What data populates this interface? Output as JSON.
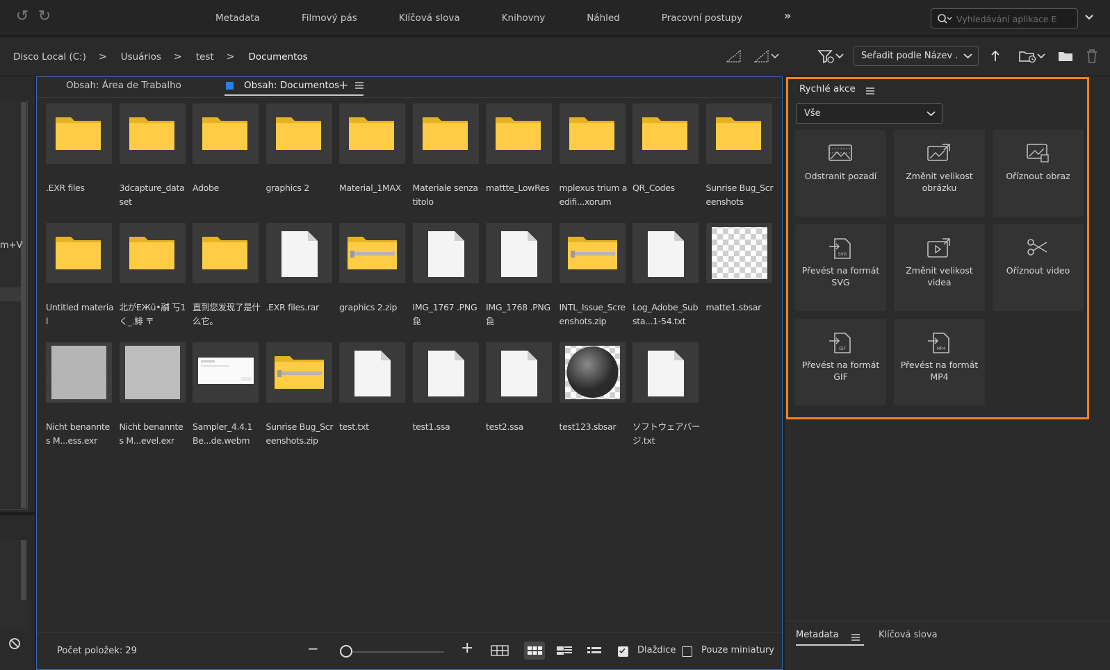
{
  "toolbar": {
    "undo_icon": "undo-icon",
    "redo_icon": "redo-icon",
    "workspaces": [
      "Metadata",
      "Filmový pás",
      "Klíčová slova",
      "Knihovny",
      "Náhled",
      "Pracovní postupy"
    ],
    "more_label": "»",
    "search_placeholder": "Vyhledávání aplikace E"
  },
  "path": {
    "crumbs": [
      "Disco Local (C:)",
      "Usuários",
      "test",
      "Documentos"
    ],
    "separator": ">",
    "sort_label": "Seřadit podle Název ."
  },
  "left_panel": {
    "partial_text": "m+V"
  },
  "content": {
    "tab1": "Obsah: Área de Trabalho",
    "tab2": "Obsah: Documentos",
    "tab_add": "+",
    "items": [
      {
        "label": ".EXR files",
        "type": "folder"
      },
      {
        "label": "3dcapture_dataset",
        "type": "folder"
      },
      {
        "label": "Adobe",
        "type": "folder"
      },
      {
        "label": "graphics 2",
        "type": "folder"
      },
      {
        "label": "Material_1MAX",
        "type": "folder"
      },
      {
        "label": "Materiale senza titolo",
        "type": "folder"
      },
      {
        "label": "mattte_LowRes",
        "type": "folder"
      },
      {
        "label": "mplexus trium aedifi...xorum",
        "type": "folder"
      },
      {
        "label": "QR_Codes",
        "type": "folder"
      },
      {
        "label": "Sunrise  Bug_Screenshots",
        "type": "folder"
      },
      {
        "label": "Untitled material",
        "type": "folder"
      },
      {
        "label": "北がEЖū•鬴 丂1く_.鯡 〒",
        "type": "folder"
      },
      {
        "label": "直到您发现了是什么它。",
        "type": "folder"
      },
      {
        "label": ".EXR files.rar",
        "type": "file"
      },
      {
        "label": "graphics 2.zip",
        "type": "zip"
      },
      {
        "label": "IMG_1767 .PNG㲋",
        "type": "file"
      },
      {
        "label": "IMG_1768 .PNG㲋",
        "type": "file"
      },
      {
        "label": "INTL_Issue_Screenshots.zip",
        "type": "zip"
      },
      {
        "label": "Log_Adobe_Substa...1-54.txt",
        "type": "file"
      },
      {
        "label": "matte1.sbsar",
        "type": "checker"
      },
      {
        "label": "Nicht benanntes M...ess.exr",
        "type": "noise"
      },
      {
        "label": "Nicht benanntes M...evel.exr",
        "type": "gray"
      },
      {
        "label": "Sampler_4.4.1 Be...de.webm",
        "type": "video"
      },
      {
        "label": "Sunrise  Bug_Screenshots.zip",
        "type": "zip"
      },
      {
        "label": "test.txt",
        "type": "file"
      },
      {
        "label": "test1.ssa",
        "type": "file"
      },
      {
        "label": "test2.ssa",
        "type": "file"
      },
      {
        "label": "test123.sbsar",
        "type": "sphere"
      },
      {
        "label": "ソフトウェアバージ.txt",
        "type": "file"
      }
    ],
    "status": {
      "count": "Počet položek: 29",
      "zoom_minus": "−",
      "zoom_plus": "+",
      "zoom_level": 0.05,
      "tiles_label": "Dlaždice",
      "tiles_checked": true,
      "thumbs_only_label": "Pouze miniatury",
      "thumbs_only_checked": false
    }
  },
  "quick_actions": {
    "title": "Rychlé akce",
    "filter": "Vše",
    "tiles": [
      {
        "label": "Odstranit pozadí",
        "icon": "remove-background-icon"
      },
      {
        "label": "Změnit velikost obrázku",
        "icon": "resize-image-icon"
      },
      {
        "label": "Oříznout obraz",
        "icon": "crop-image-icon"
      },
      {
        "label": "Převést na formát SVG",
        "icon": "convert-svg-icon"
      },
      {
        "label": "Změnit velikost videa",
        "icon": "resize-video-icon"
      },
      {
        "label": "Oříznout video",
        "icon": "trim-video-icon"
      },
      {
        "label": "Převést na formát GIF",
        "icon": "convert-gif-icon"
      },
      {
        "label": "Převést na formát MP4",
        "icon": "convert-mp4-icon"
      }
    ],
    "accent": "#f58220"
  },
  "bottom_tabs": [
    "Metadata",
    "Klíčová slova"
  ]
}
